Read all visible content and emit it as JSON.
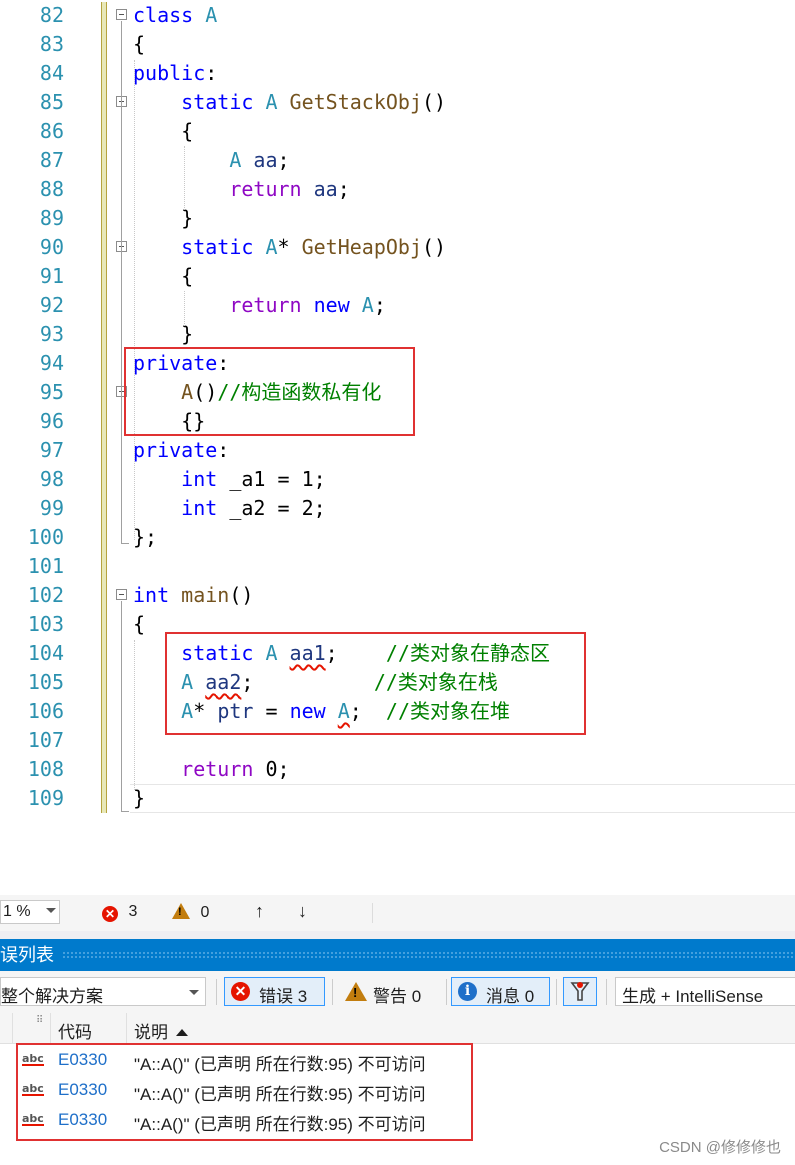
{
  "editor": {
    "lines": [
      {
        "no": "82",
        "segs": [
          {
            "t": "class ",
            "c": "kw"
          },
          {
            "t": "A",
            "c": "ty"
          }
        ]
      },
      {
        "no": "83",
        "segs": [
          {
            "t": "{",
            "c": ""
          }
        ]
      },
      {
        "no": "84",
        "segs": [
          {
            "t": "public",
            "c": "kw"
          },
          {
            "t": ":",
            "c": ""
          }
        ]
      },
      {
        "no": "85",
        "segs": [
          {
            "t": "    static ",
            "c": "kw"
          },
          {
            "t": "A ",
            "c": "ty"
          },
          {
            "t": "GetStackObj",
            "c": "fn"
          },
          {
            "t": "()",
            "c": ""
          }
        ]
      },
      {
        "no": "86",
        "segs": [
          {
            "t": "    {",
            "c": ""
          }
        ]
      },
      {
        "no": "87",
        "segs": [
          {
            "t": "        A ",
            "c": "ty"
          },
          {
            "t": "aa",
            "c": "var"
          },
          {
            "t": ";",
            "c": ""
          }
        ]
      },
      {
        "no": "88",
        "segs": [
          {
            "t": "        return ",
            "c": "ctl"
          },
          {
            "t": "aa",
            "c": "var"
          },
          {
            "t": ";",
            "c": ""
          }
        ]
      },
      {
        "no": "89",
        "segs": [
          {
            "t": "    }",
            "c": ""
          }
        ]
      },
      {
        "no": "90",
        "segs": [
          {
            "t": "    static ",
            "c": "kw"
          },
          {
            "t": "A",
            "c": "ty"
          },
          {
            "t": "* ",
            "c": ""
          },
          {
            "t": "GetHeapObj",
            "c": "fn"
          },
          {
            "t": "()",
            "c": ""
          }
        ]
      },
      {
        "no": "91",
        "segs": [
          {
            "t": "    {",
            "c": ""
          }
        ]
      },
      {
        "no": "92",
        "segs": [
          {
            "t": "        return ",
            "c": "ctl"
          },
          {
            "t": "new ",
            "c": "kw"
          },
          {
            "t": "A",
            "c": "ty"
          },
          {
            "t": ";",
            "c": ""
          }
        ]
      },
      {
        "no": "93",
        "segs": [
          {
            "t": "    }",
            "c": ""
          }
        ]
      },
      {
        "no": "94",
        "segs": [
          {
            "t": "private",
            "c": "kw"
          },
          {
            "t": ":",
            "c": ""
          }
        ]
      },
      {
        "no": "95",
        "segs": [
          {
            "t": "    A",
            "c": "fn"
          },
          {
            "t": "()",
            "c": ""
          },
          {
            "t": "//构造函数私有化",
            "c": "cm"
          }
        ]
      },
      {
        "no": "96",
        "segs": [
          {
            "t": "    {}",
            "c": ""
          }
        ]
      },
      {
        "no": "97",
        "segs": [
          {
            "t": "private",
            "c": "kw"
          },
          {
            "t": ":",
            "c": ""
          }
        ]
      },
      {
        "no": "98",
        "segs": [
          {
            "t": "    int ",
            "c": "kw"
          },
          {
            "t": "_a1 = 1;",
            "c": ""
          }
        ]
      },
      {
        "no": "99",
        "segs": [
          {
            "t": "    int ",
            "c": "kw"
          },
          {
            "t": "_a2 = 2;",
            "c": ""
          }
        ]
      },
      {
        "no": "100",
        "segs": [
          {
            "t": "};",
            "c": ""
          }
        ]
      },
      {
        "no": "101",
        "segs": []
      },
      {
        "no": "102",
        "segs": [
          {
            "t": "int ",
            "c": "kw"
          },
          {
            "t": "main",
            "c": "fn"
          },
          {
            "t": "()",
            "c": ""
          }
        ]
      },
      {
        "no": "103",
        "segs": [
          {
            "t": "{",
            "c": ""
          }
        ]
      },
      {
        "no": "104",
        "segs": [
          {
            "t": "    static ",
            "c": "kw"
          },
          {
            "t": "A ",
            "c": "ty"
          },
          {
            "t": "aa1",
            "c": "var squig"
          },
          {
            "t": ";    ",
            "c": ""
          },
          {
            "t": "//类对象在静态区",
            "c": "cm"
          }
        ]
      },
      {
        "no": "105",
        "segs": [
          {
            "t": "    A ",
            "c": "ty"
          },
          {
            "t": "aa2",
            "c": "var squig"
          },
          {
            "t": ";          ",
            "c": ""
          },
          {
            "t": "//类对象在栈",
            "c": "cm"
          }
        ]
      },
      {
        "no": "106",
        "segs": [
          {
            "t": "    A",
            "c": "ty"
          },
          {
            "t": "* ",
            "c": ""
          },
          {
            "t": "ptr",
            "c": "var"
          },
          {
            "t": " = ",
            "c": ""
          },
          {
            "t": "new ",
            "c": "kw"
          },
          {
            "t": "A",
            "c": "ty squig"
          },
          {
            "t": ";  ",
            "c": ""
          },
          {
            "t": "//类对象在堆",
            "c": "cm"
          }
        ]
      },
      {
        "no": "107",
        "segs": []
      },
      {
        "no": "108",
        "segs": [
          {
            "t": "    return ",
            "c": "ctl"
          },
          {
            "t": "0;",
            "c": ""
          }
        ]
      },
      {
        "no": "109",
        "segs": [
          {
            "t": "}",
            "c": ""
          }
        ]
      }
    ]
  },
  "status": {
    "zoom": "1 %",
    "errors": "3",
    "warnings": "0",
    "up": "↑",
    "down": "↓"
  },
  "panel": {
    "title": "误列表"
  },
  "toolbar": {
    "scope": "整个解决方案",
    "errors_label": "错误 3",
    "warnings_label": "警告 0",
    "messages_label": "消息 0",
    "build_filter": "生成 + IntelliSense"
  },
  "grid": {
    "col_code": "代码",
    "col_desc": "说明",
    "rows": [
      {
        "icon": "abc",
        "code": "E0330",
        "desc": "\"A::A()\" (已声明 所在行数:95) 不可访问"
      },
      {
        "icon": "abc",
        "code": "E0330",
        "desc": "\"A::A()\" (已声明 所在行数:95) 不可访问"
      },
      {
        "icon": "abc",
        "code": "E0330",
        "desc": "\"A::A()\" (已声明 所在行数:95) 不可访问"
      }
    ]
  },
  "watermark": "CSDN @修修修也"
}
